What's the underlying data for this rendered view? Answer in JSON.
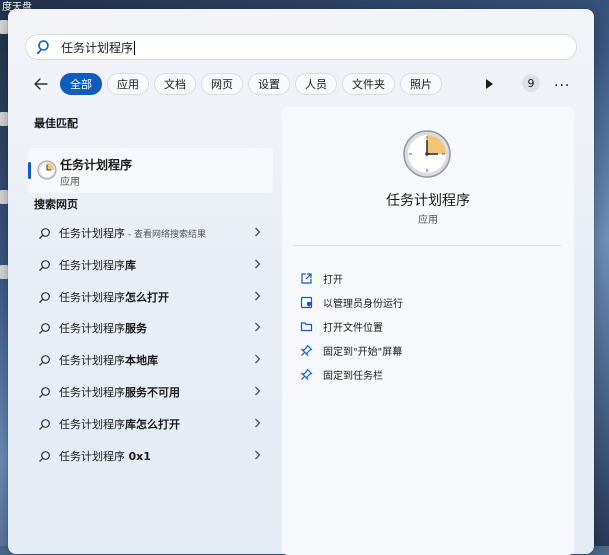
{
  "desktop": {
    "top_left_text": "度天盘"
  },
  "search": {
    "query": "任务计划程序"
  },
  "filters": {
    "back_icon": "back-arrow-icon",
    "chips": [
      "全部",
      "应用",
      "文档",
      "网页",
      "设置",
      "人员",
      "文件夹",
      "照片"
    ],
    "result_count": "9",
    "more": "..."
  },
  "best_match": {
    "heading": "最佳匹配",
    "title": "任务计划程序",
    "subtitle": "应用"
  },
  "web_search": {
    "heading": "搜索网页",
    "items": [
      {
        "base": "任务计划程序",
        "bold": "",
        "suffix": " - 查看网络搜索结果"
      },
      {
        "base": "任务计划程序",
        "bold": "库",
        "suffix": ""
      },
      {
        "base": "任务计划程序",
        "bold": "怎么打开",
        "suffix": ""
      },
      {
        "base": "任务计划程序",
        "bold": "服务",
        "suffix": ""
      },
      {
        "base": "任务计划程序",
        "bold": "本地库",
        "suffix": ""
      },
      {
        "base": "任务计划程序",
        "bold": "服务不可用",
        "suffix": ""
      },
      {
        "base": "任务计划程序",
        "bold": "库怎么打开",
        "suffix": ""
      },
      {
        "base": "任务计划程序 ",
        "bold": "0x1",
        "suffix": ""
      }
    ]
  },
  "detail": {
    "title": "任务计划程序",
    "subtitle": "应用",
    "actions": [
      {
        "label": "打开",
        "icon": "open-external-icon"
      },
      {
        "label": "以管理员身份运行",
        "icon": "shield-icon"
      },
      {
        "label": "打开文件位置",
        "icon": "folder-icon"
      },
      {
        "label": "固定到\"开始\"屏幕",
        "icon": "pin-icon"
      },
      {
        "label": "固定到任务栏",
        "icon": "pin-icon"
      }
    ]
  },
  "colors": {
    "accent": "#0f5cbe",
    "panel": "#eef2f8"
  }
}
